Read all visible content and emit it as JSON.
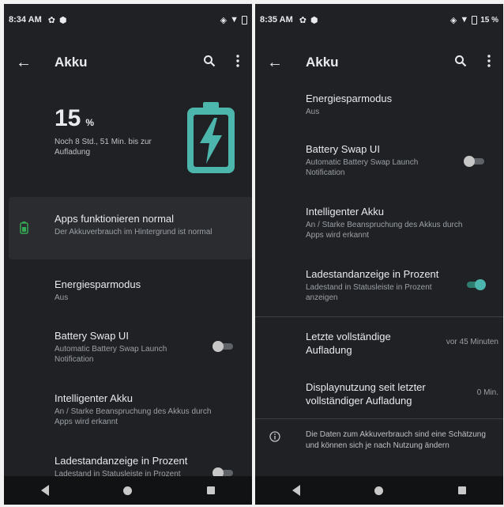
{
  "colors": {
    "accent": "#4db6ac",
    "battery_icon": "#4db6ac",
    "background": "#202124",
    "card": "#2b2c2f"
  },
  "left": {
    "status": {
      "time": "8:34 AM",
      "percent": ""
    },
    "appbar": {
      "title": "Akku",
      "icons": [
        "back-arrow-icon",
        "search-icon",
        "more-vert-icon"
      ]
    },
    "battery": {
      "level": "15",
      "unit": "%",
      "remaining": "Noch 8 Std., 51 Min. bis zur Aufladung",
      "icon": "battery-charging-icon"
    },
    "status_card": {
      "title": "Apps funktionieren normal",
      "subtitle": "Der Akkuverbrauch im Hintergrund ist normal",
      "icon": "battery-ok-icon"
    },
    "items": [
      {
        "title": "Energiesparmodus",
        "subtitle": "Aus"
      },
      {
        "title": "Battery Swap UI",
        "subtitle": "Automatic Battery Swap Launch Notification",
        "toggle": false
      },
      {
        "title": "Intelligenter Akku",
        "subtitle": "An / Starke Beanspruchung des Akkus durch Apps wird erkannt"
      },
      {
        "title": "Ladestandanzeige in Prozent",
        "subtitle": "Ladestand in Statusleiste in Prozent anzeigen",
        "toggle": false
      }
    ]
  },
  "right": {
    "status": {
      "time": "8:35 AM",
      "percent": "15 %"
    },
    "appbar": {
      "title": "Akku",
      "icons": [
        "back-arrow-icon",
        "search-icon",
        "more-vert-icon"
      ]
    },
    "items": [
      {
        "title": "Energiesparmodus",
        "subtitle": "Aus"
      },
      {
        "title": "Battery Swap UI",
        "subtitle": "Automatic Battery Swap Launch Notification",
        "toggle": false
      },
      {
        "title": "Intelligenter Akku",
        "subtitle": "An / Starke Beanspruchung des Akkus durch Apps wird erkannt"
      },
      {
        "title": "Ladestandanzeige in Prozent",
        "subtitle": "Ladestand in Statusleiste in Prozent anzeigen",
        "toggle": true
      }
    ],
    "stats": [
      {
        "label": "Letzte vollständige Aufladung",
        "value": "vor 45 Minuten"
      },
      {
        "label": "Displaynutzung seit letzter vollständiger Aufladung",
        "value": "0 Min."
      }
    ],
    "info": {
      "text": "Die Daten zum Akkuverbrauch sind eine Schätzung und können sich je nach Nutzung ändern",
      "icon": "info-icon"
    }
  }
}
